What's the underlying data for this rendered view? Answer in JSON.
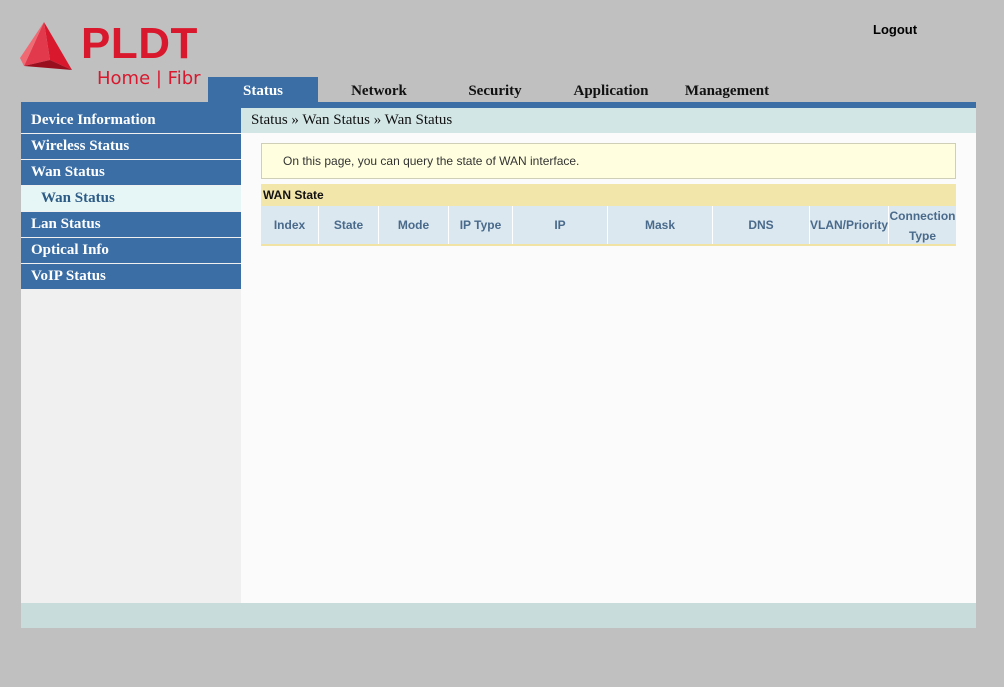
{
  "brand": {
    "name": "PLDT",
    "subline": "Home | Fibr",
    "color": "#d9182d"
  },
  "header": {
    "logout_label": "Logout"
  },
  "topnav": {
    "tabs": [
      {
        "label": "Status",
        "active": true
      },
      {
        "label": "Network",
        "active": false
      },
      {
        "label": "Security",
        "active": false
      },
      {
        "label": "Application",
        "active": false
      },
      {
        "label": "Management",
        "active": false
      }
    ]
  },
  "sidebar": {
    "items": [
      {
        "label": "Device Information"
      },
      {
        "label": "Wireless Status"
      },
      {
        "label": "Wan Status"
      },
      {
        "label": "Wan Status",
        "sub": true,
        "selected": true
      },
      {
        "label": "Lan Status"
      },
      {
        "label": "Optical Info"
      },
      {
        "label": "VoIP Status"
      }
    ]
  },
  "main": {
    "breadcrumb": "Status » Wan Status » Wan Status",
    "info_text": "On this page, you can query the state of WAN interface.",
    "wan_table": {
      "title": "WAN State",
      "columns": [
        "Index",
        "State",
        "Mode",
        "IP Type",
        "IP",
        "Mask",
        "DNS",
        "VLAN/Priority"
      ],
      "last_column_line1": "Connection",
      "last_column_line2": "Type",
      "rows": []
    }
  },
  "colors": {
    "nav_blue": "#3a6ea5",
    "breadcrumb_bg": "#d3e6e6",
    "info_bg": "#ffffe0",
    "table_title_bg": "#f3e6ab",
    "table_head_bg": "#dbe8ef"
  }
}
